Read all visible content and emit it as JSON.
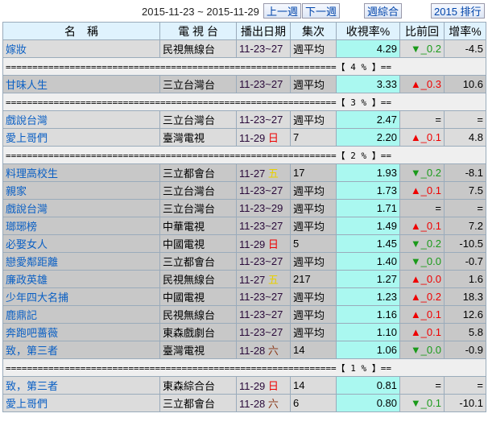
{
  "toolbar": {
    "range": "2015-11-23 ~ 2015-11-29",
    "prev": "上一週",
    "next": "下一週",
    "summary": "週綜合",
    "ranking": "2015 排行"
  },
  "headers": [
    "名　稱",
    "電 視 台",
    "播出日期",
    "集次",
    "收視率%",
    "比前回",
    "增率%"
  ],
  "sections": [
    {
      "sep": null,
      "shade": "l",
      "rows": [
        {
          "name": "嫁妝",
          "station": "民視無線台",
          "date": "11-23~27",
          "day": "",
          "ep": "週平均",
          "rating": "4.29",
          "dir": "down",
          "change": "0.2",
          "rate": "-4.5"
        }
      ]
    },
    {
      "sep": "【 4 % 】==",
      "shade": "d",
      "rows": [
        {
          "name": "甘味人生",
          "station": "三立台灣台",
          "date": "11-23~27",
          "day": "",
          "ep": "週平均",
          "rating": "3.33",
          "dir": "up",
          "change": "0.3",
          "rate": "10.6"
        }
      ]
    },
    {
      "sep": "【 3 % 】==",
      "shade": "l",
      "rows": [
        {
          "name": "戲說台灣",
          "station": "三立台灣台",
          "date": "11-23~27",
          "day": "",
          "ep": "週平均",
          "rating": "2.47",
          "dir": "eq",
          "change": "=",
          "rate": "="
        },
        {
          "name": "愛上哥們",
          "station": "臺灣電視",
          "date": "11-29",
          "day": "日",
          "ep": "7",
          "rating": "2.20",
          "dir": "up",
          "change": "0.1",
          "rate": "4.8"
        }
      ]
    },
    {
      "sep": "【 2 % 】==",
      "shade": "d",
      "rows": [
        {
          "name": "料理高校生",
          "station": "三立都會台",
          "date": "11-27",
          "day": "五",
          "ep": "17",
          "rating": "1.93",
          "dir": "down",
          "change": "0.2",
          "rate": "-8.1"
        },
        {
          "name": "親家",
          "station": "三立台灣台",
          "date": "11-23~27",
          "day": "",
          "ep": "週平均",
          "rating": "1.73",
          "dir": "up",
          "change": "0.1",
          "rate": "7.5"
        },
        {
          "name": "戲說台灣",
          "station": "三立台灣台",
          "date": "11-23~29",
          "day": "",
          "ep": "週平均",
          "rating": "1.71",
          "dir": "eq",
          "change": "=",
          "rate": "="
        },
        {
          "name": "瑯琊榜",
          "station": "中華電視",
          "date": "11-23~27",
          "day": "",
          "ep": "週平均",
          "rating": "1.49",
          "dir": "up",
          "change": "0.1",
          "rate": "7.2"
        },
        {
          "name": "必娶女人",
          "station": "中國電視",
          "date": "11-29",
          "day": "日",
          "ep": "5",
          "rating": "1.45",
          "dir": "down",
          "change": "0.2",
          "rate": "-10.5"
        },
        {
          "name": "戀愛鄰距離",
          "station": "三立都會台",
          "date": "11-23~27",
          "day": "",
          "ep": "週平均",
          "rating": "1.40",
          "dir": "down",
          "change": "0.0",
          "rate": "-0.7"
        },
        {
          "name": "廉政英雄",
          "station": "民視無線台",
          "date": "11-27",
          "day": "五",
          "ep": "217",
          "rating": "1.27",
          "dir": "up",
          "change": "0.0",
          "rate": "1.6"
        },
        {
          "name": "少年四大名捕",
          "station": "中國電視",
          "date": "11-23~27",
          "day": "",
          "ep": "週平均",
          "rating": "1.23",
          "dir": "up",
          "change": "0.2",
          "rate": "18.3"
        },
        {
          "name": "鹿鼎記",
          "station": "民視無線台",
          "date": "11-23~27",
          "day": "",
          "ep": "週平均",
          "rating": "1.16",
          "dir": "up",
          "change": "0.1",
          "rate": "12.6"
        },
        {
          "name": "奔跑吧薔薇",
          "station": "東森戲劇台",
          "date": "11-23~27",
          "day": "",
          "ep": "週平均",
          "rating": "1.10",
          "dir": "up",
          "change": "0.1",
          "rate": "5.8"
        },
        {
          "name": "致，第三者",
          "station": "臺灣電視",
          "date": "11-28",
          "day": "六",
          "ep": "14",
          "rating": "1.06",
          "dir": "down",
          "change": "0.0",
          "rate": "-0.9"
        }
      ]
    },
    {
      "sep": "【 1 % 】==",
      "shade": "l",
      "rows": [
        {
          "name": "致，第三者",
          "station": "東森綜合台",
          "date": "11-29",
          "day": "日",
          "ep": "14",
          "rating": "0.81",
          "dir": "eq",
          "change": "=",
          "rate": "="
        },
        {
          "name": "愛上哥們",
          "station": "三立都會台",
          "date": "11-28",
          "day": "六",
          "ep": "6",
          "rating": "0.80",
          "dir": "down",
          "change": "0.1",
          "rate": "-10.1"
        }
      ]
    }
  ]
}
